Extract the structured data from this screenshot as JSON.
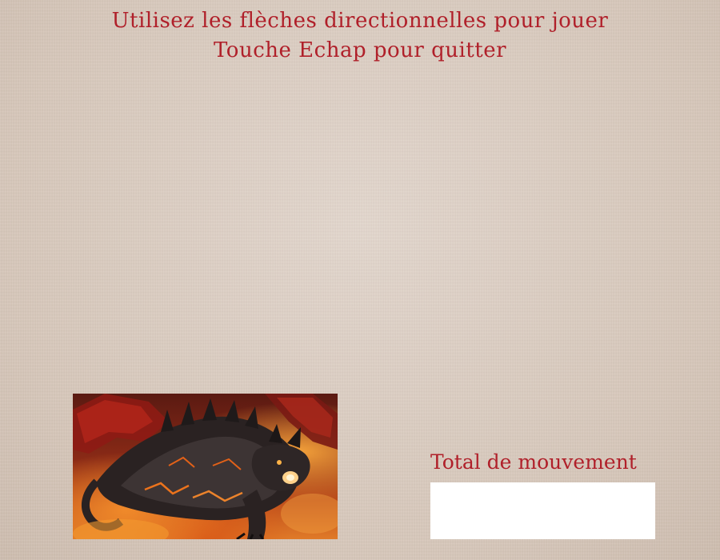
{
  "instructions": {
    "line1": "Utilisez les flèches directionnelles pour jouer",
    "line2": "Touche Echap pour quitter"
  },
  "moves": {
    "label": "Total de mouvement",
    "value": ""
  },
  "colors": {
    "text": "#b0202a",
    "background": "#d8c9bd",
    "counter_background": "#ffffff"
  },
  "image": {
    "subject": "dragon"
  }
}
